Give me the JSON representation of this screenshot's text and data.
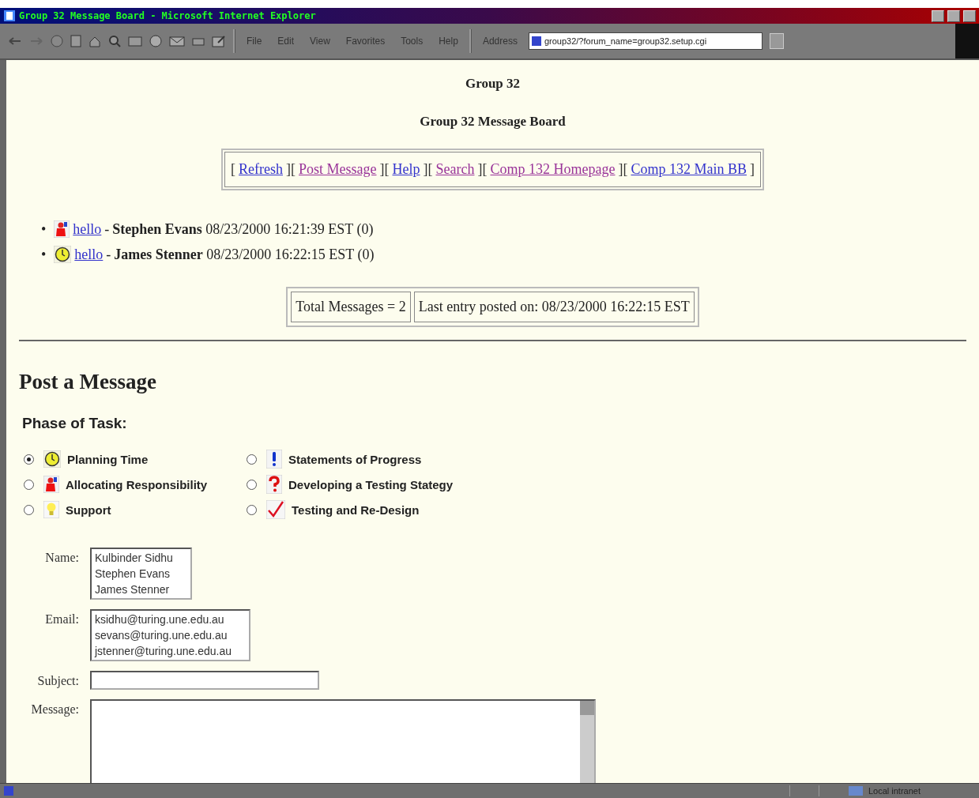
{
  "window": {
    "title": "Group 32 Message Board - Microsoft Internet Explorer"
  },
  "menu": [
    "File",
    "Edit",
    "View",
    "Favorites",
    "Tools",
    "Help"
  ],
  "address": {
    "label": "Address",
    "value": "group32/?forum_name=group32.setup.cgi"
  },
  "page": {
    "title": "Group 32",
    "subtitle": "Group 32 Message Board"
  },
  "nav_links": [
    {
      "open": "[",
      "label": "Refresh",
      "close": "]",
      "visited": false
    },
    {
      "open": "[",
      "label": "Post Message",
      "close": "]",
      "visited": true
    },
    {
      "open": "[",
      "label": "Help",
      "close": "]",
      "visited": false
    },
    {
      "open": "[",
      "label": "Search",
      "close": "]",
      "visited": true
    },
    {
      "open": "[",
      "label": "Comp 132 Homepage",
      "close": "]",
      "visited": true
    },
    {
      "open": "[",
      "label": "Comp 132 Main BB",
      "close": "]",
      "visited": false
    }
  ],
  "messages": [
    {
      "bullet": "•",
      "kind": "person",
      "subject": "hello",
      "separator": "-",
      "author": "Stephen Evans",
      "posted": "08/23/2000 16:21:39 EST (0)"
    },
    {
      "bullet": "•",
      "kind": "clock",
      "subject": "hello",
      "separator": "-",
      "author": "James Stenner",
      "posted": "08/23/2000 16:22:15 EST (0)"
    }
  ],
  "summary": [
    "Total Messages = 2",
    "Last entry posted on: 08/23/2000 16:22:15 EST"
  ],
  "form": {
    "heading": "Post a Message",
    "phase_label": "Phase of Task:",
    "phases": [
      {
        "kind": "clock",
        "label": "Planning Time",
        "selected": true
      },
      {
        "kind": "exclaim",
        "label": "Statements of Progress",
        "selected": false
      },
      {
        "kind": "person",
        "label": "Allocating Responsibility",
        "selected": false
      },
      {
        "kind": "question",
        "label": "Developing a Testing Stategy",
        "selected": false
      },
      {
        "kind": "bulb",
        "label": "Support",
        "selected": false
      },
      {
        "kind": "tick",
        "label": "Testing and Re-Design",
        "selected": false
      }
    ],
    "fields": [
      {
        "label": "Name:",
        "kind": "list",
        "lines": [
          "Kulbinder Sidhu",
          "Stephen Evans",
          "James Stenner"
        ]
      },
      {
        "label": "Email:",
        "kind": "list",
        "lines": [
          "ksidhu@turing.une.edu.au",
          "sevans@turing.une.edu.au",
          "jstenner@turing.une.edu.au"
        ]
      },
      {
        "label": "Subject:",
        "kind": "line"
      },
      {
        "label": "Message:",
        "kind": "area"
      }
    ]
  },
  "status_bar": {
    "zone": "Local intranet"
  }
}
